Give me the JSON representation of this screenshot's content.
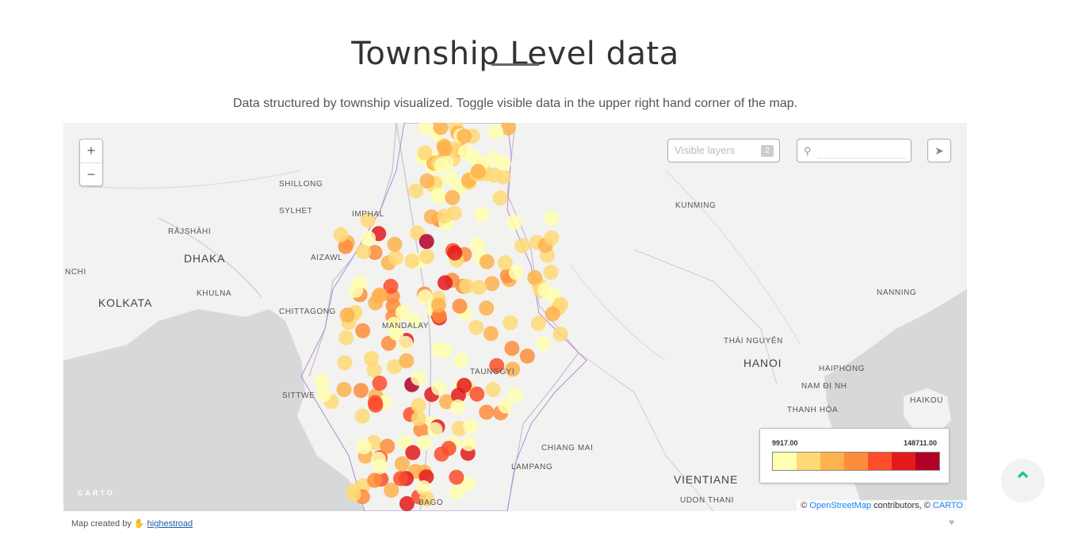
{
  "page": {
    "title": "Township Level data",
    "subtitle": "Data structured by township visualized. Toggle visible data in the upper right hand corner of the map."
  },
  "map": {
    "zoom_in": "+",
    "zoom_out": "−",
    "layers_label": "Visible layers",
    "layers_count": "2",
    "search_value": "",
    "search_icon": "search-icon",
    "share_icon": "paper-plane-icon",
    "logo": "CARTO",
    "cities": {
      "shillong": "SHILLONG",
      "sylhet": "SYLHET",
      "imphal": "IMPHAL",
      "rajshahi": "RĀJSHĀHI",
      "dhaka": "DHAKA",
      "aizawl": "AIZAWL",
      "nchi": "NCHI",
      "khulna": "KHULNA",
      "kolkata": "KOLKATA",
      "chittagong": "CHITTAGONG",
      "mandalay": "MANDALAY",
      "taunggyi": "TAUNGGYI",
      "sittwe": "SITTWE",
      "kunming": "KUNMING",
      "nanning": "NANNING",
      "thainguyen": "THÁI NGUYÊN",
      "hanoi": "HANOI",
      "haiphong": "HAIPHONG",
      "namdinh": "NAM ĐỊ NH",
      "haikou": "HAIKOU",
      "thanhhoa": "THANH HÓA",
      "chiangmai": "CHIANG MAI",
      "lampang": "LAMPANG",
      "vientiane": "VIENTIANE",
      "udonthani": "UDON THANI",
      "bago": "BAGO"
    },
    "legend": {
      "min": "9917.00",
      "max": "148711.00",
      "colors": [
        "#ffffb2",
        "#fed976",
        "#feb24c",
        "#fd8d3c",
        "#fc4e2a",
        "#e31a1c",
        "#b10026"
      ]
    },
    "attribution": {
      "prefix": "© ",
      "osm": "OpenStreetMap",
      "middle": " contributors, © ",
      "carto": "CARTO"
    }
  },
  "footer": {
    "created_by": "Map created by",
    "author": "highestroad",
    "heart_icon": "heart-icon"
  },
  "scroll_top_icon": "chevron-up-icon"
}
